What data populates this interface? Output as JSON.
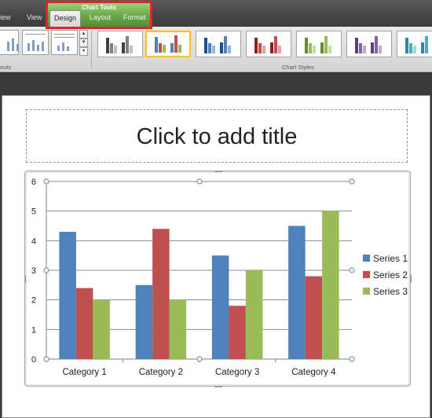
{
  "ribbon": {
    "tabs": [
      {
        "label": "iew"
      },
      {
        "label": "View"
      },
      {
        "label": "Design"
      },
      {
        "label": "Layout"
      },
      {
        "label": "Format"
      }
    ],
    "context_title": "Chart Tools",
    "group_layouts_label": "outs",
    "group_styles_label": "Chart Styles"
  },
  "slide": {
    "title_placeholder": "Click to add title"
  },
  "chart_data": {
    "type": "bar",
    "categories": [
      "Category 1",
      "Category 2",
      "Category 3",
      "Category 4"
    ],
    "series": [
      {
        "name": "Series 1",
        "values": [
          4.3,
          2.5,
          3.5,
          4.5
        ],
        "color": "#4f81bd"
      },
      {
        "name": "Series 2",
        "values": [
          2.4,
          4.4,
          1.8,
          2.8
        ],
        "color": "#c0504d"
      },
      {
        "name": "Series 3",
        "values": [
          2,
          2,
          3,
          5
        ],
        "color": "#9bbb59"
      }
    ],
    "ylim": [
      0,
      6
    ],
    "yticks": [
      "0",
      "1",
      "2",
      "3",
      "4",
      "5",
      "6"
    ],
    "grid": true,
    "legend": "right"
  },
  "colors": {
    "chart_tools_tab": "#6aa84a",
    "highlight_box": "#e2232b",
    "selected_style": "#f0c040"
  }
}
